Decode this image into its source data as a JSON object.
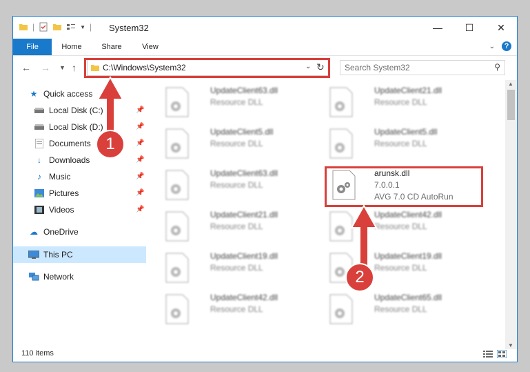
{
  "window": {
    "title": "System32",
    "controls": [
      "minimize",
      "maximize",
      "close"
    ]
  },
  "ribbon": {
    "tabs": [
      "File",
      "Home",
      "Share",
      "View"
    ],
    "help_label": "?"
  },
  "navigation": {
    "address": "C:\\Windows\\System32",
    "search_placeholder": "Search System32"
  },
  "sidebar": {
    "quick_access": "Quick access",
    "items": [
      "Local Disk (C:)",
      "Local Disk (D:)",
      "Documents",
      "Downloads",
      "Music",
      "Pictures",
      "Videos"
    ],
    "onedrive": "OneDrive",
    "this_pc": "This PC",
    "network": "Network"
  },
  "files": {
    "left": [
      {
        "name": "UpdateClient63.dll",
        "type": "Resource DLL"
      },
      {
        "name": "UpdateClient5.dll",
        "type": "Resource DLL"
      },
      {
        "name": "UpdateClient63.dll",
        "type": "Resource DLL"
      },
      {
        "name": "UpdateClient21.dll",
        "type": "Resource DLL"
      },
      {
        "name": "UpdateClient19.dll",
        "type": "Resource DLL"
      },
      {
        "name": "UpdateClient42.dll",
        "type": "Resource DLL"
      }
    ],
    "right": [
      {
        "name": "UpdateClient21.dll",
        "type": "Resource DLL"
      },
      {
        "name": "UpdateClient5.dll",
        "type": "Resource DLL"
      },
      {
        "name": "arunsk.dll",
        "type": "7.0.0.1",
        "desc": "AVG 7.0 CD AutoRun"
      },
      {
        "name": "UpdateClient42.dll",
        "type": "Resource DLL"
      },
      {
        "name": "UpdateClient19.dll",
        "type": "Resource DLL"
      },
      {
        "name": "UpdateClient65.dll",
        "type": "Resource DLL"
      }
    ]
  },
  "status": {
    "item_count": "110 items"
  },
  "annotations": {
    "badge1": "1",
    "badge2": "2",
    "accent_color": "#d9403b"
  }
}
